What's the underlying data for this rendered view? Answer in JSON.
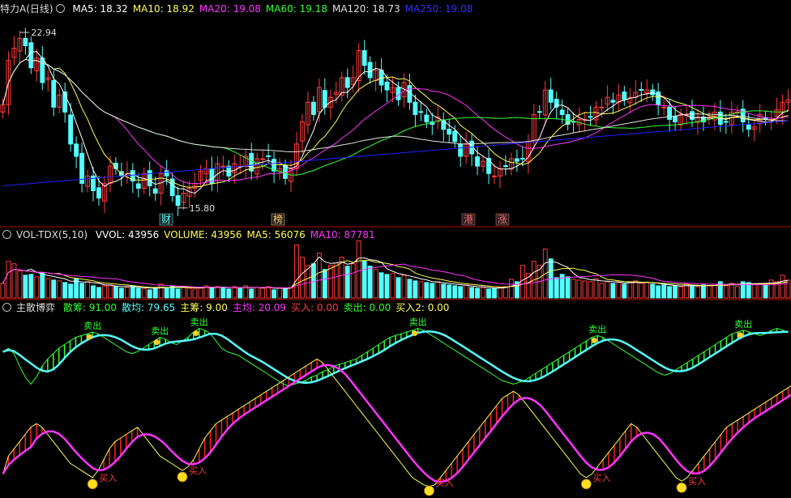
{
  "colors": {
    "up": "#ff3b3b",
    "down": "#54ffff",
    "ma5": "#ffffff",
    "ma10": "#ffff55",
    "ma20": "#ff33ff",
    "ma60": "#33ff33",
    "ma120": "#e0e0e0",
    "ma250": "#2020ff",
    "divider": "#b00000"
  },
  "price_panel": {
    "title": "特力A(日线)",
    "ma_labels": [
      {
        "label": "MA5: 18.32",
        "color": "#ffffff"
      },
      {
        "label": "MA10: 18.92",
        "color": "#ffff55"
      },
      {
        "label": "MA20: 19.08",
        "color": "#ff33ff"
      },
      {
        "label": "MA60: 19.18",
        "color": "#33ff33"
      },
      {
        "label": "MA120: 18.73",
        "color": "#e0e0e0"
      },
      {
        "label": "MA250: 19.08",
        "color": "#3030ff"
      }
    ],
    "annotations": {
      "high": "22.94",
      "low": "15.80"
    },
    "event_tags": [
      "财",
      "榜",
      "港",
      "涨"
    ]
  },
  "volume_panel": {
    "title": "VOL-TDX(5,10)",
    "labels": [
      {
        "label": "VVOL: 43956",
        "color": "#ffffff"
      },
      {
        "label": "VOLUME: 43956",
        "color": "#ffff55"
      },
      {
        "label": "MA5: 56076",
        "color": "#ffff55"
      },
      {
        "label": "MA10: 87781",
        "color": "#ff33ff"
      }
    ]
  },
  "indicator_panel": {
    "title": "主散博弈",
    "labels": [
      {
        "label": "散筹: 91.00",
        "color": "#33ff33"
      },
      {
        "label": "散均: 79.65",
        "color": "#54ffff"
      },
      {
        "label": "主筹: 9.00",
        "color": "#ffff55"
      },
      {
        "label": "主均: 20.09",
        "color": "#ff33ff"
      },
      {
        "label": "买入: 0.00",
        "color": "#ff3b3b"
      },
      {
        "label": "卖出: 0.00",
        "color": "#33ff33"
      },
      {
        "label": "买入2: 0.00",
        "color": "#ffff55"
      }
    ],
    "sell_signal_label": "卖出",
    "buy_signal_label": "买入"
  },
  "chart_data": [
    {
      "type": "candlestick",
      "title": "特力A(日线)",
      "ylim": [
        15.2,
        23.6
      ],
      "high_annotation": 22.94,
      "low_annotation": 15.8,
      "series": [
        {
          "name": "MA5",
          "values": [
            18.32
          ]
        },
        {
          "name": "MA10",
          "values": [
            18.92
          ]
        },
        {
          "name": "MA20",
          "values": [
            19.08
          ]
        },
        {
          "name": "MA60",
          "values": [
            19.18
          ]
        },
        {
          "name": "MA120",
          "values": [
            18.73
          ]
        },
        {
          "name": "MA250",
          "values": [
            19.08
          ]
        }
      ],
      "close": [
        20.0,
        21.8,
        22.3,
        22.7,
        22.4,
        21.5,
        21.9,
        20.9,
        21.1,
        19.9,
        20.4,
        19.7,
        18.4,
        17.9,
        16.8,
        17.1,
        16.5,
        16.2,
        16.8,
        17.5,
        17.4,
        17.1,
        17.2,
        16.9,
        16.6,
        17.2,
        16.7,
        16.4,
        17.2,
        17.1,
        16.3,
        15.9,
        16.4,
        16.6,
        16.8,
        17.3,
        17.4,
        16.8,
        17.6,
        17.5,
        17.1,
        17.6,
        17.5,
        17.9,
        17.3,
        17.8,
        17.8,
        17.9,
        17.3,
        17.4,
        17.0,
        17.4,
        18.4,
        19.3,
        20.1,
        19.6,
        20.7,
        19.9,
        20.3,
        20.5,
        21.1,
        20.7,
        21.1,
        22.2,
        21.6,
        21.1,
        21.4,
        20.8,
        20.6,
        20.7,
        20.2,
        20.9,
        20.1,
        19.6,
        19.7,
        19.3,
        19.2,
        19.5,
        19.0,
        18.8,
        18.5,
        17.9,
        18.4,
        18.0,
        17.5,
        17.7,
        17.2,
        17.1,
        17.4,
        17.5,
        17.8,
        17.7,
        17.8,
        18.5,
        19.6,
        19.7,
        20.6,
        20.1,
        19.9,
        19.6,
        19.2,
        19.3,
        19.4,
        19.4,
        19.5,
        19.9,
        19.9,
        20.3,
        20.1,
        20.4,
        20.2,
        20.3,
        20.5,
        20.6,
        20.6,
        20.4,
        20.0,
        19.9,
        19.4,
        19.3,
        19.6,
        19.6,
        19.4,
        19.5,
        19.3,
        19.5,
        19.7,
        19.2,
        19.3,
        19.7,
        19.7,
        19.3,
        19.0,
        19.1,
        19.6,
        19.4,
        19.4,
        19.8,
        20.1,
        20.2
      ],
      "volume": [
        36000,
        90000,
        84000,
        66000,
        56000,
        58000,
        52000,
        62000,
        48000,
        44000,
        42000,
        38000,
        34000,
        48000,
        36000,
        40000,
        30000,
        26000,
        30000,
        32000,
        28000,
        24000,
        26000,
        30000,
        24000,
        22000,
        20000,
        24000,
        34000,
        26000,
        30000,
        22000,
        28000,
        24000,
        22000,
        26000,
        30000,
        24000,
        28000,
        26000,
        22000,
        28000,
        24000,
        30000,
        22000,
        26000,
        24000,
        28000,
        20000,
        24000,
        22000,
        26000,
        130000,
        100000,
        80000,
        84000,
        110000,
        70000,
        80000,
        86000,
        100000,
        78000,
        84000,
        140000,
        90000,
        78000,
        70000,
        62000,
        58000,
        60000,
        50000,
        56000,
        46000,
        42000,
        40000,
        38000,
        36000,
        40000,
        34000,
        32000,
        30000,
        28000,
        32000,
        26000,
        24000,
        26000,
        22000,
        24000,
        26000,
        28000,
        46000,
        40000,
        80000,
        60000,
        90000,
        80000,
        120000,
        96000,
        50000,
        58000,
        52000,
        46000,
        44000,
        42000,
        40000,
        48000,
        36000,
        40000,
        36000,
        38000,
        34000,
        40000,
        42000,
        36000,
        38000,
        34000,
        30000,
        32000,
        28000,
        30000,
        28000,
        34000,
        30000,
        28000,
        32000,
        30000,
        34000,
        40000,
        30000,
        36000,
        28000,
        40000,
        38000,
        34000,
        36000,
        32000,
        44000,
        40000,
        56000,
        43956
      ]
    },
    {
      "type": "line",
      "title": "主散博弈",
      "ylim": [
        0,
        100
      ],
      "series": [
        {
          "name": "散筹",
          "values": [
            91.0
          ]
        },
        {
          "name": "散均",
          "values": [
            79.65
          ]
        },
        {
          "name": "主筹",
          "values": [
            9.0
          ]
        },
        {
          "name": "主均",
          "values": [
            20.09
          ]
        },
        {
          "name": "买入",
          "values": [
            0.0
          ]
        },
        {
          "name": "卖出",
          "values": [
            0.0
          ]
        },
        {
          "name": "买入2",
          "values": [
            0.0
          ]
        }
      ],
      "scatter_upper_values": [
        80,
        82,
        79,
        72,
        66,
        62,
        66,
        72,
        76,
        79,
        82,
        84,
        86,
        88,
        89,
        90,
        91,
        90,
        88,
        86,
        84,
        82,
        80,
        79,
        80,
        82,
        84,
        86,
        88,
        87,
        85,
        84,
        86,
        88,
        91,
        93,
        92,
        90,
        86,
        82,
        80,
        79,
        78,
        76,
        74,
        72,
        70,
        68,
        66,
        64,
        62,
        61,
        62,
        63,
        64,
        66,
        67,
        69,
        70,
        72,
        73,
        74,
        75,
        76,
        78,
        80,
        82,
        84,
        86,
        88,
        89,
        90,
        91,
        92,
        93,
        92,
        90,
        88,
        86,
        84,
        82,
        80,
        78,
        76,
        74,
        72,
        70,
        68,
        66,
        64,
        63,
        62,
        63,
        64,
        66,
        68,
        70,
        72,
        74,
        76,
        78,
        80,
        82,
        84,
        86,
        88,
        89,
        88,
        86,
        84,
        82,
        80,
        78,
        76,
        74,
        72,
        70,
        68,
        67,
        68,
        70,
        72,
        74,
        76,
        78,
        80,
        82,
        84,
        86,
        88,
        90,
        91,
        92,
        91,
        90,
        89,
        90,
        92,
        93,
        92,
        91
      ],
      "main_lower_values": [
        12,
        22,
        26,
        30,
        34,
        38,
        40,
        38,
        34,
        30,
        26,
        22,
        18,
        16,
        14,
        12,
        10,
        14,
        20,
        26,
        30,
        32,
        34,
        36,
        38,
        34,
        30,
        26,
        22,
        20,
        18,
        16,
        14,
        16,
        20,
        26,
        32,
        36,
        40,
        42,
        44,
        46,
        48,
        50,
        52,
        54,
        56,
        58,
        60,
        62,
        64,
        66,
        68,
        70,
        72,
        74,
        76,
        74,
        70,
        66,
        62,
        58,
        54,
        50,
        46,
        42,
        38,
        34,
        30,
        26,
        22,
        18,
        14,
        10,
        8,
        6,
        5,
        6,
        10,
        14,
        18,
        22,
        26,
        30,
        34,
        38,
        42,
        46,
        50,
        54,
        56,
        58,
        56,
        52,
        48,
        44,
        40,
        36,
        32,
        28,
        24,
        20,
        16,
        12,
        10,
        12,
        16,
        20,
        24,
        28,
        32,
        36,
        40,
        38,
        34,
        30,
        26,
        22,
        18,
        14,
        10,
        8,
        10,
        14,
        18,
        22,
        26,
        30,
        34,
        38,
        40,
        42,
        44,
        46,
        48,
        50,
        52,
        54,
        56,
        58,
        60,
        62,
        64,
        66,
        68
      ]
    }
  ]
}
